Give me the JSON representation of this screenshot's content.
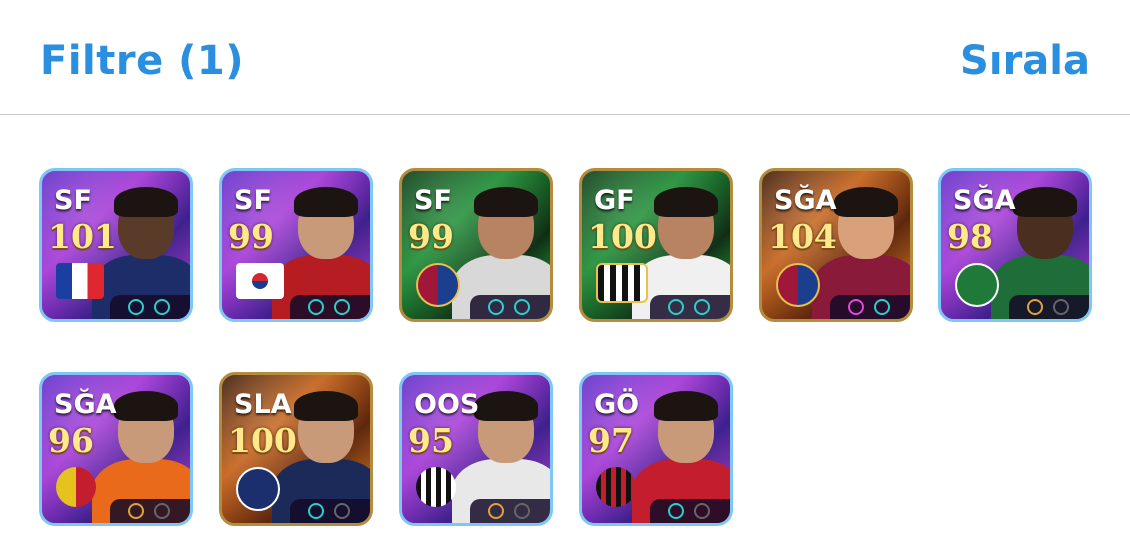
{
  "header": {
    "filter_label": "Filtre (1)",
    "sort_label": "Sırala"
  },
  "cards": [
    {
      "position": "SF",
      "rating": "101"
    },
    {
      "position": "SF",
      "rating": "99"
    },
    {
      "position": "SF",
      "rating": "99"
    },
    {
      "position": "GF",
      "rating": "100"
    },
    {
      "position": "SĞA",
      "rating": "104"
    },
    {
      "position": "SĞA",
      "rating": "98"
    },
    {
      "position": "SĞA",
      "rating": "96"
    },
    {
      "position": "SLA",
      "rating": "100"
    },
    {
      "position": "OOS",
      "rating": "95"
    },
    {
      "position": "GÖ",
      "rating": "97"
    }
  ],
  "colors": {
    "accent": "#2b8fe0",
    "rating": "#ffe98a"
  }
}
